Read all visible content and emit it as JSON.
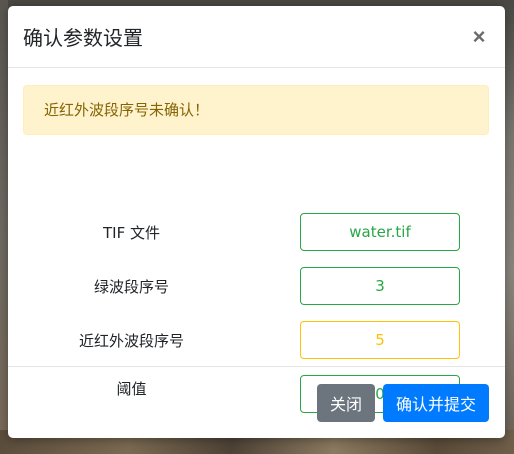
{
  "modal": {
    "title": "确认参数设置",
    "close_icon": "×"
  },
  "alert": {
    "text": "近红外波段序号未确认！"
  },
  "fields": [
    {
      "label": "TIF 文件",
      "value": "water.tif",
      "status": "valid"
    },
    {
      "label": "绿波段序号",
      "value": "3",
      "status": "valid"
    },
    {
      "label": "近红外波段序号",
      "value": "5",
      "status": "warning"
    },
    {
      "label": "阈值",
      "value": "0",
      "status": "valid"
    }
  ],
  "footer": {
    "close_label": "关闭",
    "confirm_label": "确认并提交"
  },
  "colors": {
    "valid": "#28a745",
    "warning": "#ffc107",
    "primary": "#007bff",
    "secondary": "#6c757d",
    "alert_bg": "#fff3cd",
    "alert_text": "#856404"
  }
}
